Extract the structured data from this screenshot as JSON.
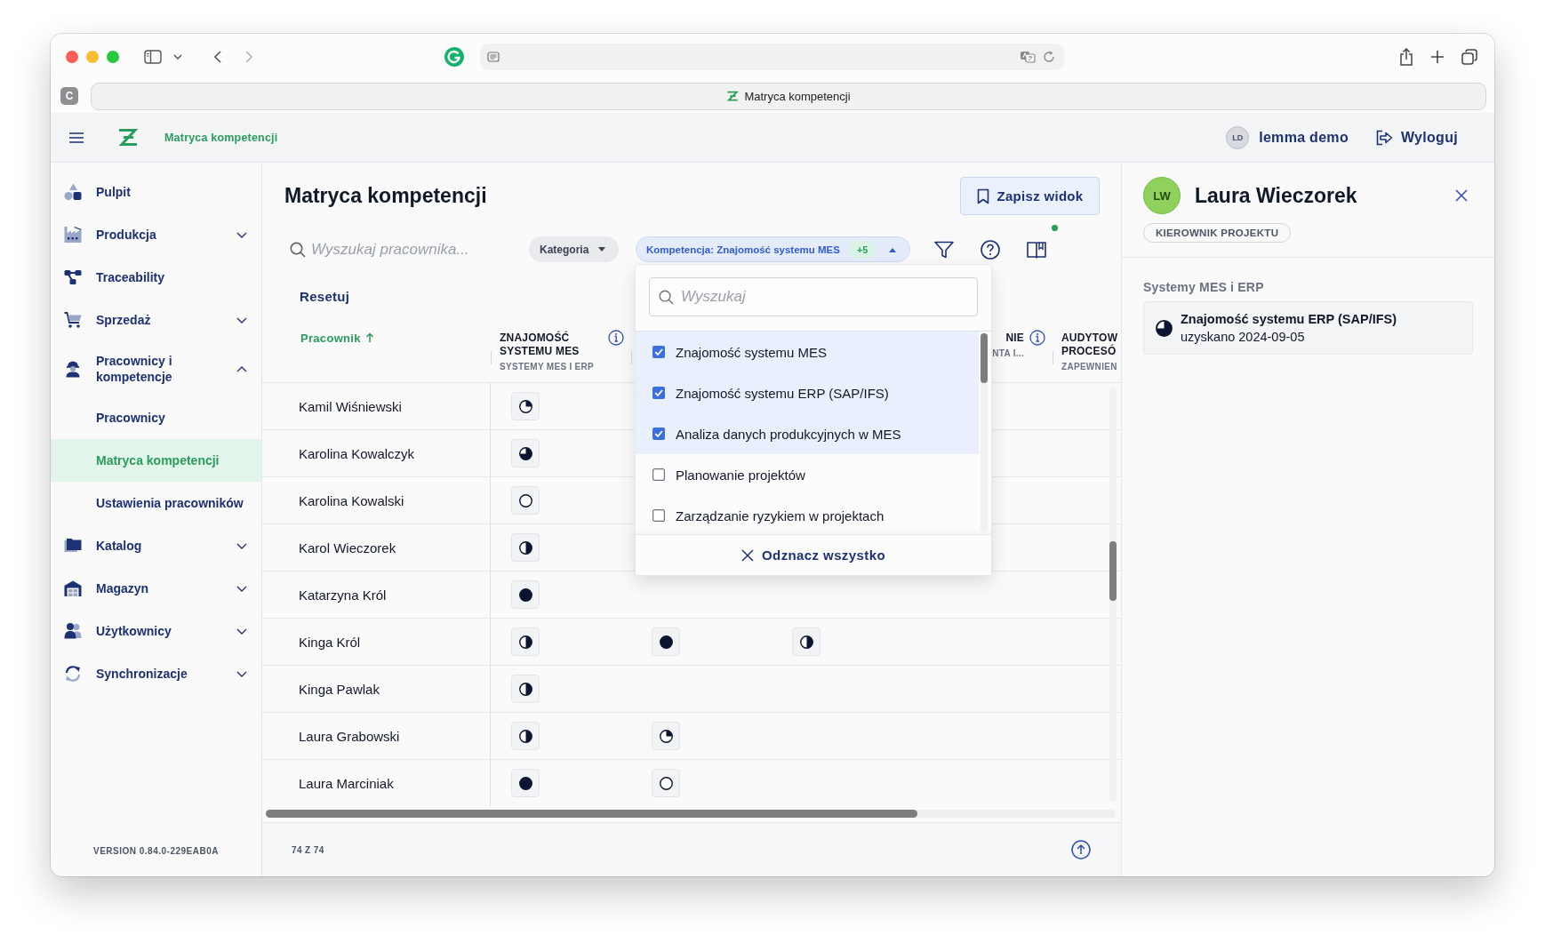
{
  "browser": {
    "site_initial": "C",
    "tab_title": "Matryca kompetencji"
  },
  "app_header": {
    "title": "Matryca kompetencji",
    "user": {
      "initials": "LD",
      "name": "lemma demo"
    },
    "logout": "Wyloguj"
  },
  "sidebar": {
    "items": [
      {
        "kind": "link",
        "label": "Pulpit",
        "selected": false
      },
      {
        "kind": "group",
        "label": "Produkcja",
        "selected": false,
        "expanded": false
      },
      {
        "kind": "link",
        "label": "Traceability",
        "selected": false
      },
      {
        "kind": "group",
        "label": "Sprzedaż",
        "selected": false,
        "expanded": false
      },
      {
        "kind": "group",
        "label": "Pracownicy i kompetencje",
        "selected": false,
        "expanded": true,
        "children": [
          {
            "label": "Pracownicy",
            "selected": false
          },
          {
            "label": "Matryca kompetencji",
            "selected": true
          },
          {
            "label": "Ustawienia pracowników",
            "selected": false
          }
        ]
      },
      {
        "kind": "group",
        "label": "Katalog",
        "selected": false,
        "expanded": false
      },
      {
        "kind": "group",
        "label": "Magazyn",
        "selected": false,
        "expanded": false
      },
      {
        "kind": "group",
        "label": "Użytkownicy",
        "selected": false,
        "expanded": false
      },
      {
        "kind": "group",
        "label": "Synchronizacje",
        "selected": false,
        "expanded": false
      }
    ],
    "version": "VERSION 0.84.0-229EAB0A"
  },
  "page": {
    "title": "Matryca kompetencji",
    "save_view": "Zapisz widok"
  },
  "filters": {
    "search": {
      "placeholder": "Wyszukaj pracownika..."
    },
    "category": {
      "label": "Kategoria",
      "open": false
    },
    "competence": {
      "label": "Kompetencja: Znajomość systemu MES",
      "extra": "+5",
      "open": true,
      "search_placeholder": "Wyszukaj",
      "options": [
        {
          "label": "Znajomość systemu MES",
          "checked": true
        },
        {
          "label": "Znajomość systemu ERP (SAP/IFS)",
          "checked": true
        },
        {
          "label": "Analiza danych produkcyjnych w MES",
          "checked": true
        },
        {
          "label": "Planowanie projektów",
          "checked": false
        },
        {
          "label": "Zarządzanie ryzykiem w projektach",
          "checked": false
        }
      ],
      "clear": "Odznacz wszystko"
    },
    "indicator_dot": true,
    "reset": "Resetuj"
  },
  "table": {
    "name_column": {
      "title": "Pracownik",
      "sort_ascending": true
    },
    "columns": [
      {
        "title": "ZNAJOMOŚĆ SYSTEMU MES",
        "subtitle": "SYSTEMY MES I ERP",
        "info": true,
        "covered": false
      },
      null,
      null,
      {
        "title": "NIE",
        "subtitle": "NTA I...",
        "info": true,
        "covered": true
      },
      {
        "title": "AUDYTOW PROCESÓ",
        "subtitle": "ZAPEWNIEN",
        "info": false,
        "covered": false
      }
    ],
    "rows": [
      {
        "name": "Kamil Wiśniewski",
        "cells": [
          {
            "kind": "quarter"
          }
        ]
      },
      {
        "name": "Karolina Kowalczyk",
        "cells": [
          {
            "kind": "three-quarters"
          }
        ]
      },
      {
        "name": "Karolina Kowalski",
        "cells": [
          {
            "kind": "empty"
          }
        ]
      },
      {
        "name": "Karol Wieczorek",
        "cells": [
          {
            "kind": "half"
          }
        ]
      },
      {
        "name": "Katarzyna Król",
        "cells": [
          {
            "kind": "full"
          }
        ]
      },
      {
        "name": "Kinga Król",
        "cells": [
          {
            "kind": "half"
          },
          {
            "kind": "full"
          },
          {
            "kind": "half"
          }
        ]
      },
      {
        "name": "Kinga Pawlak",
        "cells": [
          {
            "kind": "half"
          }
        ]
      },
      {
        "name": "Laura Grabowski",
        "cells": [
          {
            "kind": "half"
          },
          {
            "kind": "quarter"
          }
        ]
      },
      {
        "name": "Laura Marciniak",
        "cells": [
          {
            "kind": "full"
          },
          {
            "kind": "empty"
          }
        ]
      }
    ]
  },
  "footer": {
    "count": "74 Z 74"
  },
  "detail_panel": {
    "initials": "LW",
    "name": "Laura Wieczorek",
    "role": "KIEROWNIK PROJEKTU",
    "sections": [
      {
        "title": "Systemy MES i ERP",
        "items": [
          {
            "name": "Znajomość systemu ERP (SAP/IFS)",
            "date": "uzyskano 2024-09-05",
            "kind": "three-quarters"
          }
        ]
      }
    ]
  }
}
